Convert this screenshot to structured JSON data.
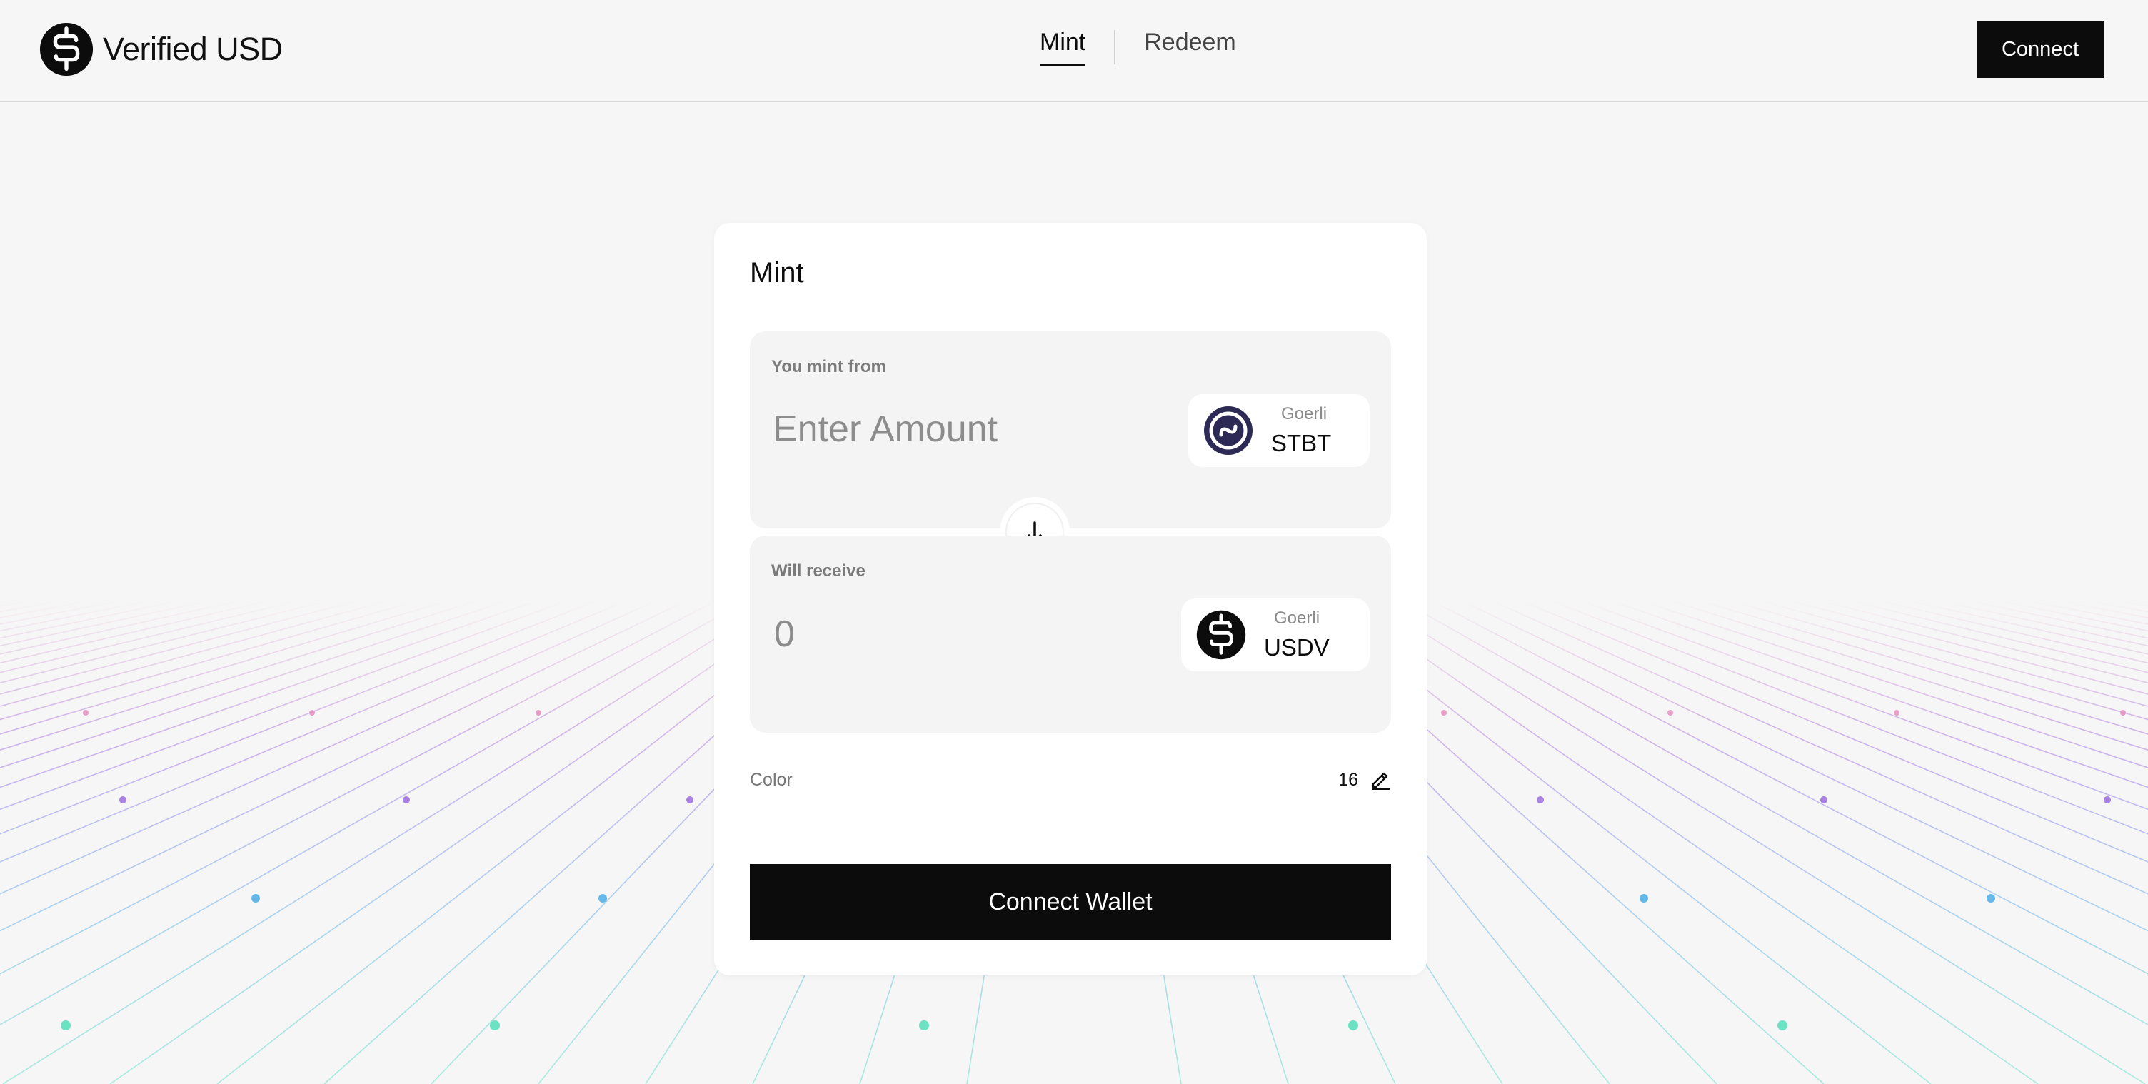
{
  "header": {
    "brand_name": "Verified USD",
    "brand_icon": "dollar-coin-icon",
    "tabs": [
      {
        "label": "Mint",
        "active": true
      },
      {
        "label": "Redeem",
        "active": false
      }
    ],
    "connect_label": "Connect"
  },
  "card": {
    "title": "Mint",
    "from": {
      "label": "You mint from",
      "placeholder": "Enter Amount",
      "token": {
        "network": "Goerli",
        "symbol": "STBT",
        "icon": "stbt-token-icon"
      }
    },
    "swap_icon": "arrow-down-icon",
    "to": {
      "label": "Will receive",
      "amount": "0",
      "token": {
        "network": "Goerli",
        "symbol": "USDV",
        "icon": "usdv-token-icon"
      }
    },
    "color": {
      "label": "Color",
      "value": "16",
      "icon": "pencil-icon"
    },
    "connect_wallet_label": "Connect Wallet"
  },
  "colors": {
    "background": "#f6f6f6",
    "primary": "#0c0c0c",
    "panel": "#f4f4f4",
    "stbt_icon": "#2d2b55"
  }
}
